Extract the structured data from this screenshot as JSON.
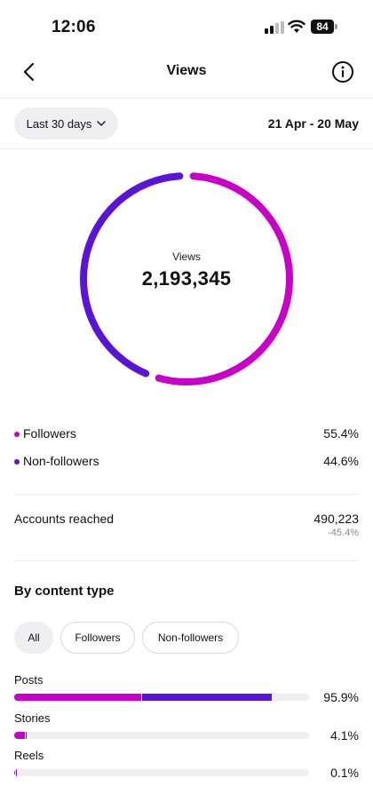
{
  "status_bar": {
    "time": "12:06",
    "battery": "84"
  },
  "header": {
    "title": "Views",
    "back_icon": "chevron-left-icon",
    "info_icon": "info-icon"
  },
  "filters": {
    "range_label": "Last 30 days",
    "date_range": "21 Apr - 20 May"
  },
  "colors": {
    "followers": "#c800c8",
    "non_followers": "#5a14d7",
    "track": "#efeff3"
  },
  "summary": {
    "label": "Views",
    "total": "2,193,345",
    "followers_fraction": 0.554,
    "non_followers_fraction": 0.446
  },
  "breakdown": [
    {
      "label": "Followers",
      "percent": "55.4%"
    },
    {
      "label": "Non-followers",
      "percent": "44.6%"
    }
  ],
  "reached": {
    "label": "Accounts reached",
    "value": "490,223",
    "change": "-45.4%"
  },
  "content_type": {
    "title": "By content type",
    "chips": [
      "All",
      "Followers",
      "Non-followers"
    ],
    "active_chip": "All",
    "rows": [
      {
        "label": "Posts",
        "percent": "95.9%",
        "followers": 0.43,
        "non_followers": 0.44
      },
      {
        "label": "Stories",
        "percent": "4.1%",
        "followers": 0.035,
        "non_followers": 0.005
      },
      {
        "label": "Reels",
        "percent": "0.1%",
        "followers": 0.002,
        "non_followers": 0.001
      }
    ]
  }
}
